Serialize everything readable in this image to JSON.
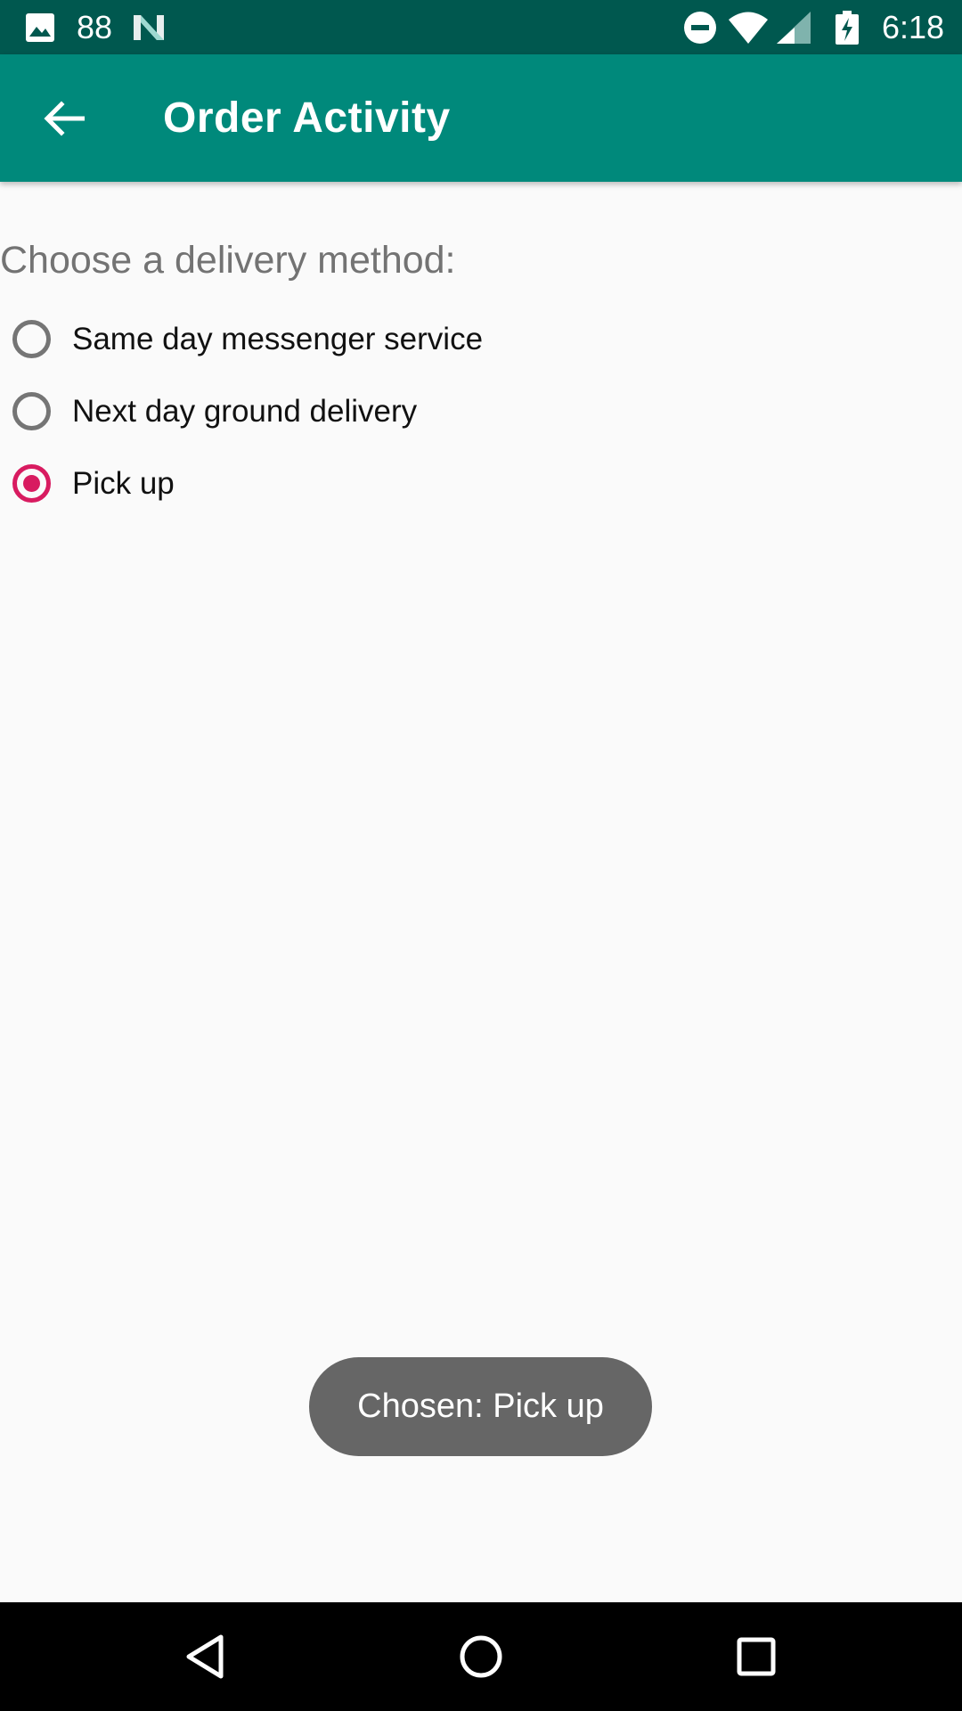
{
  "status_bar": {
    "notification_count": "88",
    "time": "6:18",
    "icons": [
      "photo-icon",
      "n-logo-icon",
      "do-not-disturb-icon",
      "wifi-icon",
      "cell-signal-icon",
      "battery-charging-icon"
    ]
  },
  "app_bar": {
    "title": "Order Activity",
    "back_icon": "arrow-back-icon"
  },
  "content": {
    "prompt": "Choose a delivery method:",
    "options": [
      {
        "label": "Same day messenger service",
        "checked": false
      },
      {
        "label": "Next day ground delivery",
        "checked": false
      },
      {
        "label": "Pick up",
        "checked": true
      }
    ]
  },
  "toast": {
    "text": "Chosen: Pick up"
  },
  "nav_bar": {
    "icons": [
      "nav-back-icon",
      "nav-home-icon",
      "nav-recents-icon"
    ]
  },
  "colors": {
    "status_bar": "#00584f",
    "app_bar": "#00897b",
    "accent": "#d81b60",
    "background": "#fafafa",
    "toast": "#666666"
  }
}
